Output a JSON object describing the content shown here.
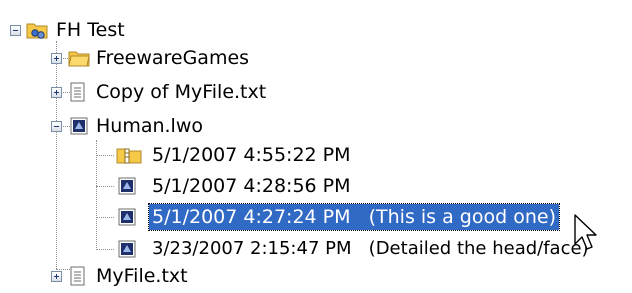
{
  "tree": {
    "root": {
      "label": "FH Test",
      "icon": "folder-network-icon",
      "expanded": true
    },
    "items": [
      {
        "label": "FreewareGames",
        "icon": "folder-icon",
        "expanded": false
      },
      {
        "label": "Copy of MyFile.txt",
        "icon": "text-file-icon",
        "expanded": false
      },
      {
        "label": "Human.lwo",
        "icon": "object-file-icon",
        "expanded": true,
        "versions": [
          {
            "label": "5/1/2007 4:55:22 PM",
            "icon": "compressed-file-icon"
          },
          {
            "label": "5/1/2007 4:28:56 PM",
            "icon": "object-file-icon"
          },
          {
            "label": "5/1/2007 4:27:24 PM   (This is a good one)",
            "icon": "object-file-icon",
            "selected": true
          },
          {
            "label": "3/23/2007 2:15:47 PM   (Detailed the head/face)",
            "icon": "object-file-icon"
          }
        ]
      },
      {
        "label": "MyFile.txt",
        "icon": "text-file-icon",
        "expanded": false
      }
    ]
  },
  "colors": {
    "selection": "#316ac5",
    "folder": "#f5c847",
    "tree_lines": "#8f8f8f"
  }
}
